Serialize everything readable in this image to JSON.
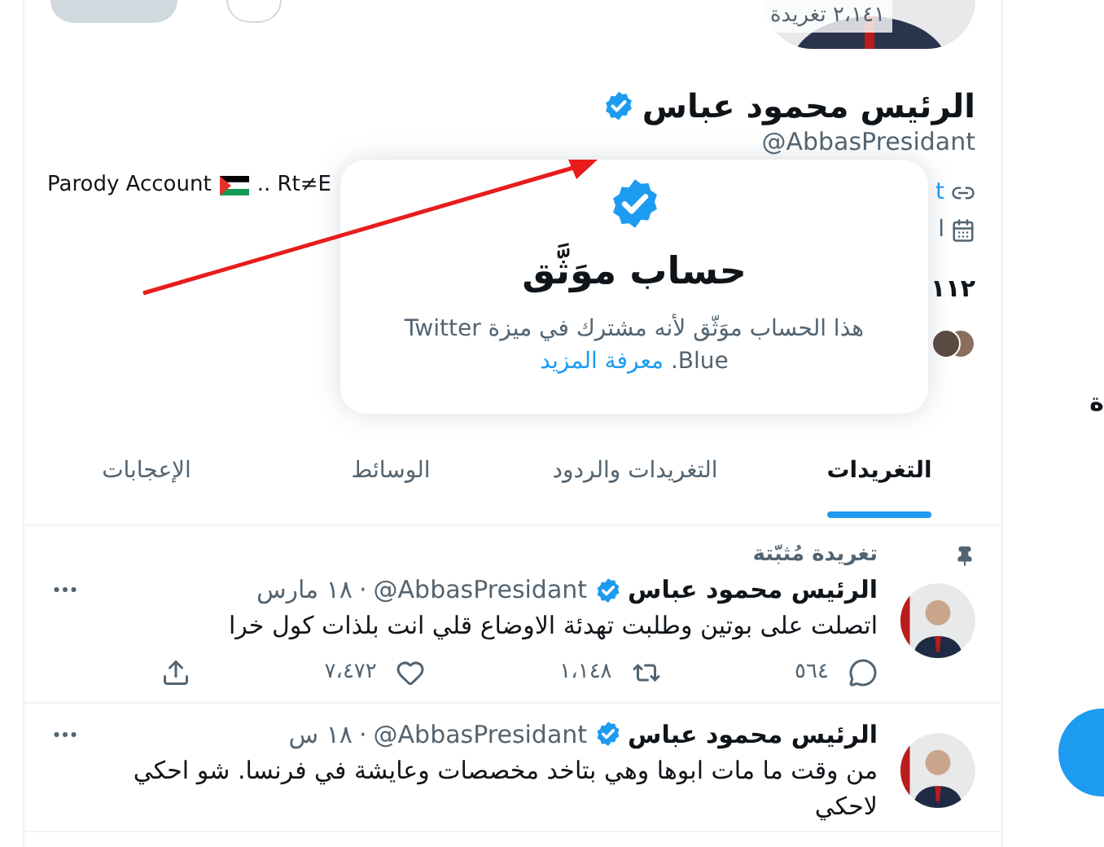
{
  "header": {
    "tweet_count": "٢،١٤١ تغريدة"
  },
  "profile": {
    "name": "الرئيس محمود عباس",
    "verified": true,
    "handle": "@AbbasPresidant",
    "bio_start": "Parody Account",
    "bio_end": ".. Rt≠E",
    "link_fragment": "t",
    "joined_fragment": "ا",
    "count_fragment": "١١٢"
  },
  "popup": {
    "title": "حساب موَثَّق",
    "body": "هذا الحساب موَثّق لأنه مشترك في ميزة Twitter Blue.",
    "link": "معرفة المزيد"
  },
  "side_fragment": "ة",
  "tabs": [
    {
      "label": "التغريدات",
      "selected": true
    },
    {
      "label": "التغريدات والردود",
      "selected": false
    },
    {
      "label": "الوسائط",
      "selected": false
    },
    {
      "label": "الإعجابات",
      "selected": false
    }
  ],
  "tweets": [
    {
      "pinned": true,
      "pinned_label": "تغريدة مُثبّتة",
      "name": "الرئيس محمود عباس",
      "verified": true,
      "handle": "@AbbasPresidant",
      "dot": "·",
      "time": "١٨ مارس",
      "text": "اتصلت على بوتين وطلبت تهدئة الاوضاع قلي انت بلذات كول خرا",
      "actions": [
        {
          "kind": "reply",
          "count": "٥٦٤"
        },
        {
          "kind": "retweet",
          "count": "١،١٤٨"
        },
        {
          "kind": "like",
          "count": "٧،٤٧٢"
        },
        {
          "kind": "share"
        }
      ]
    },
    {
      "pinned": false,
      "name": "الرئيس محمود عباس",
      "verified": true,
      "handle": "@AbbasPresidant",
      "dot": "·",
      "time": "١٨ س",
      "text": "من وقت ما مات ابوها وهي بتاخد مخصصات وعايشة في فرنسا. شو احكي لاحكي"
    }
  ]
}
